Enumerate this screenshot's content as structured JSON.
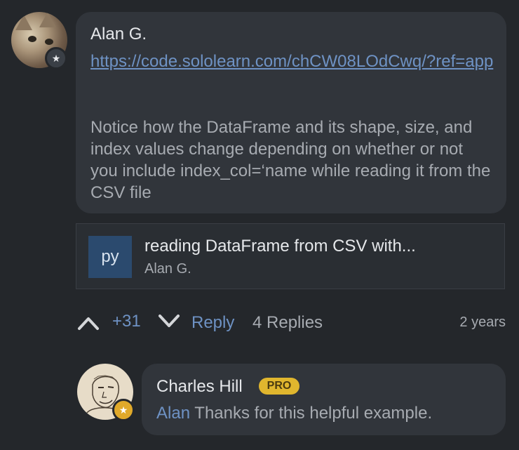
{
  "comment": {
    "author": "Alan G.",
    "link": "https://code.sololearn.com/chCW08LOdCwq/?ref=app",
    "body": "Notice how the DataFrame and its shape, size, and index values change depending on whether or not you include index_col=‘name while reading it from the CSV file",
    "code_card": {
      "language": "py",
      "title": "reading DataFrame from CSV with...",
      "author": "Alan G."
    },
    "actions": {
      "votes": "+31",
      "reply_label": "Reply",
      "replies_label": "4 Replies",
      "time": "2 years"
    }
  },
  "reply": {
    "author": "Charles Hill",
    "badge": "PRO",
    "mention": "Alan",
    "text": " Thanks for this helpful example."
  },
  "icons": [
    "star-icon",
    "chevron-up-icon",
    "chevron-down-icon"
  ]
}
